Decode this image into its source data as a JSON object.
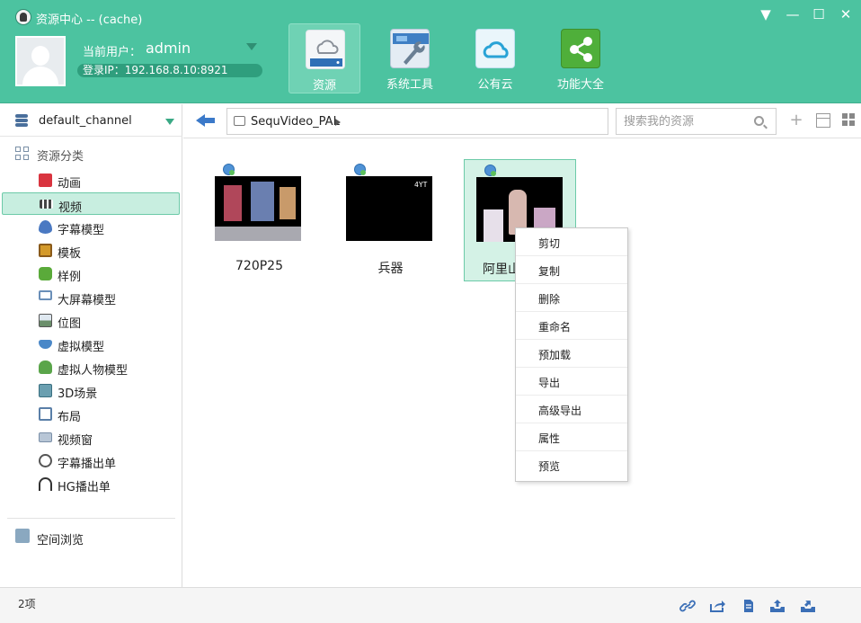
{
  "window": {
    "title": "资源中心 -- (cache)",
    "controls": {
      "menu": "▼",
      "minimize": "—",
      "maximize": "☐",
      "close": "✕"
    }
  },
  "user": {
    "label": "当前用户：",
    "name": "admin",
    "login_ip": "登录IP：192.168.8.10:8921"
  },
  "nav_tabs": [
    {
      "label": "资源",
      "icon": "cloud-drive-icon",
      "active": true
    },
    {
      "label": "系统工具",
      "icon": "toolbox-icon",
      "active": false
    },
    {
      "label": "公有云",
      "icon": "public-cloud-icon",
      "active": false
    },
    {
      "label": "功能大全",
      "icon": "share-icon",
      "active": false
    }
  ],
  "sidebar": {
    "channel": "default_channel",
    "category_header": "资源分类",
    "items": [
      {
        "label": "动画",
        "icon": "animation-icon",
        "color": "#d9343f"
      },
      {
        "label": "视频",
        "icon": "clapperboard-icon",
        "color": "#444444",
        "selected": true
      },
      {
        "label": "字幕模型",
        "icon": "drop-icon",
        "color": "#4a79c2"
      },
      {
        "label": "模板",
        "icon": "template-icon",
        "color": "#d49a2a"
      },
      {
        "label": "样例",
        "icon": "puzzle-icon",
        "color": "#5aaa3a"
      },
      {
        "label": "大屏幕模型",
        "icon": "monitor-icon",
        "color": "#6a8fb8"
      },
      {
        "label": "位图",
        "icon": "bitmap-icon",
        "color": "#6b8f6b"
      },
      {
        "label": "虚拟模型",
        "icon": "teapot-icon",
        "color": "#4a88c8"
      },
      {
        "label": "虚拟人物模型",
        "icon": "person-icon",
        "color": "#5aa54a"
      },
      {
        "label": "3D场景",
        "icon": "cube-icon",
        "color": "#6a9fb0"
      },
      {
        "label": "布局",
        "icon": "layout-icon",
        "color": "#5a7fa8"
      },
      {
        "label": "视频窗",
        "icon": "video-window-icon",
        "color": "#7a8fa8"
      },
      {
        "label": "字幕播出单",
        "icon": "clock-list-icon",
        "color": "#555555"
      },
      {
        "label": "HG播出单",
        "icon": "headphones-icon",
        "color": "#333333"
      }
    ],
    "space_browse": "空间浏览"
  },
  "toolbar": {
    "path": "SequVideo_PAL",
    "search_placeholder": "搜索我的资源",
    "add": "+"
  },
  "files": [
    {
      "name": "720P25"
    },
    {
      "name": "兵器"
    },
    {
      "name": "阿里山"
    }
  ],
  "thumb_logo": "4YT",
  "context_menu": [
    "剪切",
    "复制",
    "删除",
    "重命名",
    "预加载",
    "导出",
    "高级导出",
    "属性",
    "预览"
  ],
  "status": {
    "count": "2项"
  },
  "colors": {
    "header": "#4cc3a0",
    "selection": "#c8eee0",
    "accent_blue": "#3b79c9"
  }
}
